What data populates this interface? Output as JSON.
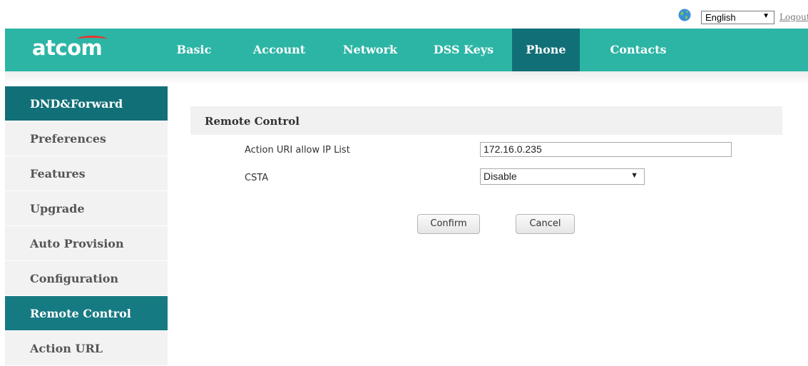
{
  "topbar": {
    "language": "English",
    "logout_label": "Logout"
  },
  "header": {
    "logo_text": "atcom",
    "nav": [
      {
        "label": "Basic"
      },
      {
        "label": "Account"
      },
      {
        "label": "Network"
      },
      {
        "label": "DSS Keys"
      },
      {
        "label": "Phone",
        "active": true
      },
      {
        "label": "Contacts"
      }
    ]
  },
  "sidebar": {
    "items": [
      {
        "label": "DND&Forward",
        "state": "highlight"
      },
      {
        "label": "Preferences"
      },
      {
        "label": "Features"
      },
      {
        "label": "Upgrade"
      },
      {
        "label": "Auto Provision"
      },
      {
        "label": "Configuration"
      },
      {
        "label": "Remote Control",
        "state": "selected"
      },
      {
        "label": "Action URL"
      }
    ]
  },
  "main": {
    "section_title": "Remote Control",
    "fields": {
      "action_uri_label": "Action URI allow IP List",
      "action_uri_value": "172.16.0.235",
      "csta_label": "CSTA",
      "csta_value": "Disable"
    },
    "buttons": {
      "confirm": "Confirm",
      "cancel": "Cancel"
    }
  },
  "colors": {
    "header_bg": "#2cb5a5",
    "active_tab_bg": "#116f77",
    "sidebar_bg": "#f2f2f2",
    "logo_accent": "#e8342f"
  },
  "icons": {
    "language": "globe-icon",
    "dropdown": "chevron-down-icon"
  }
}
